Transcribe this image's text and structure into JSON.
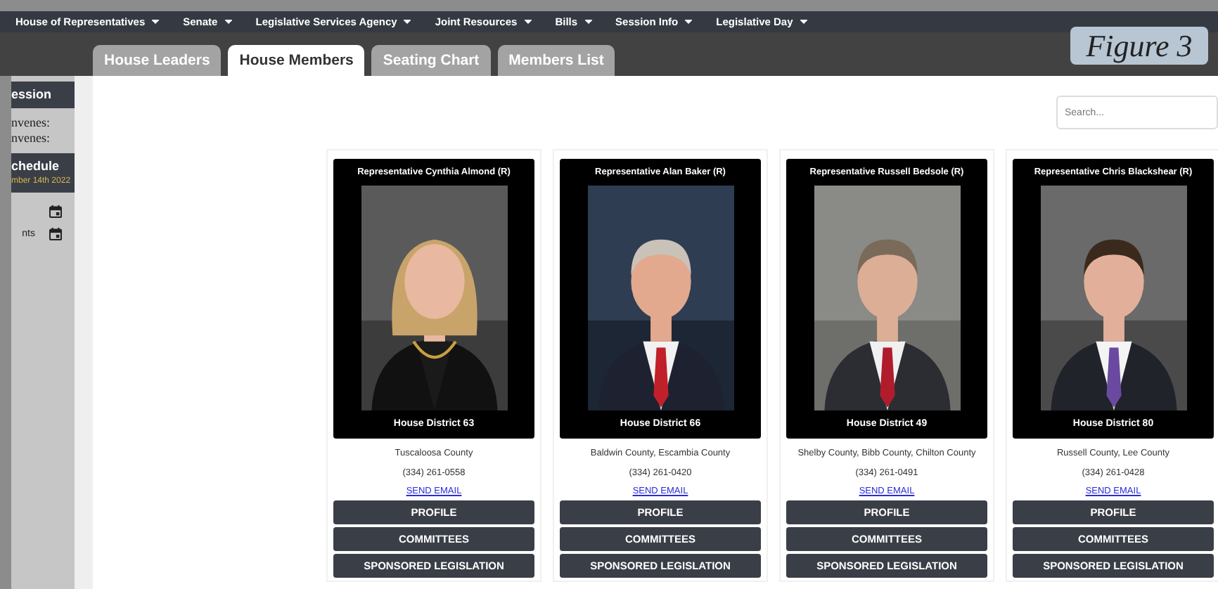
{
  "nav": [
    {
      "label": "House of Representatives"
    },
    {
      "label": "Senate"
    },
    {
      "label": "Legislative Services Agency"
    },
    {
      "label": "Joint Resources"
    },
    {
      "label": "Bills"
    },
    {
      "label": "Session Info"
    },
    {
      "label": "Legislative Day"
    }
  ],
  "tabs": [
    {
      "label": "House Leaders",
      "selected": false
    },
    {
      "label": "House Members",
      "selected": true
    },
    {
      "label": "Seating Chart",
      "selected": false
    },
    {
      "label": "Members List",
      "selected": false
    }
  ],
  "figure_label": "Figure 3",
  "sidebar": [
    {
      "kind": "header",
      "label": "ession"
    },
    {
      "kind": "text",
      "label": "nvenes:"
    },
    {
      "kind": "text",
      "label": "nvenes:"
    },
    {
      "kind": "header",
      "label": "chedule",
      "subtitle": "mber 14th 2022"
    },
    {
      "kind": "icon_row"
    },
    {
      "kind": "icon_row",
      "label": "nts"
    }
  ],
  "search": {
    "placeholder": "Search..."
  },
  "members": [
    {
      "name": "Representative Cynthia Almond (R)",
      "picture": {
        "kind": "picture"
      },
      "district": "House District 63",
      "counties": "Tuscaloosa County",
      "phone": "(334) 261-0558",
      "link": "SEND EMAIL",
      "buttons": [
        "PROFILE",
        "COMMITTEES",
        "SPONSORED LEGISLATION"
      ]
    },
    {
      "name": "Representative Alan Baker (R)",
      "picture": {
        "kind": "picture"
      },
      "district": "House District 66",
      "counties": "Baldwin County, Escambia County",
      "phone": "(334) 261-0420",
      "link": "SEND EMAIL",
      "buttons": [
        "PROFILE",
        "COMMITTEES",
        "SPONSORED LEGISLATION"
      ]
    },
    {
      "name": "Representative Russell Bedsole (R)",
      "picture": {
        "kind": "picture"
      },
      "district": "House District 49",
      "counties": "Shelby County, Bibb County, Chilton County",
      "phone": "(334) 261-0491",
      "link": "SEND EMAIL",
      "buttons": [
        "PROFILE",
        "COMMITTEES",
        "SPONSORED LEGISLATION"
      ]
    },
    {
      "name": "Representative Chris Blackshear (R)",
      "picture": {
        "kind": "picture"
      },
      "district": "House District 80",
      "counties": "Russell County, Lee County",
      "phone": "(334) 261-0428",
      "link": "SEND EMAIL",
      "buttons": [
        "PROFILE",
        "COMMITTEES",
        "SPONSORED LEGISLATION"
      ]
    }
  ]
}
